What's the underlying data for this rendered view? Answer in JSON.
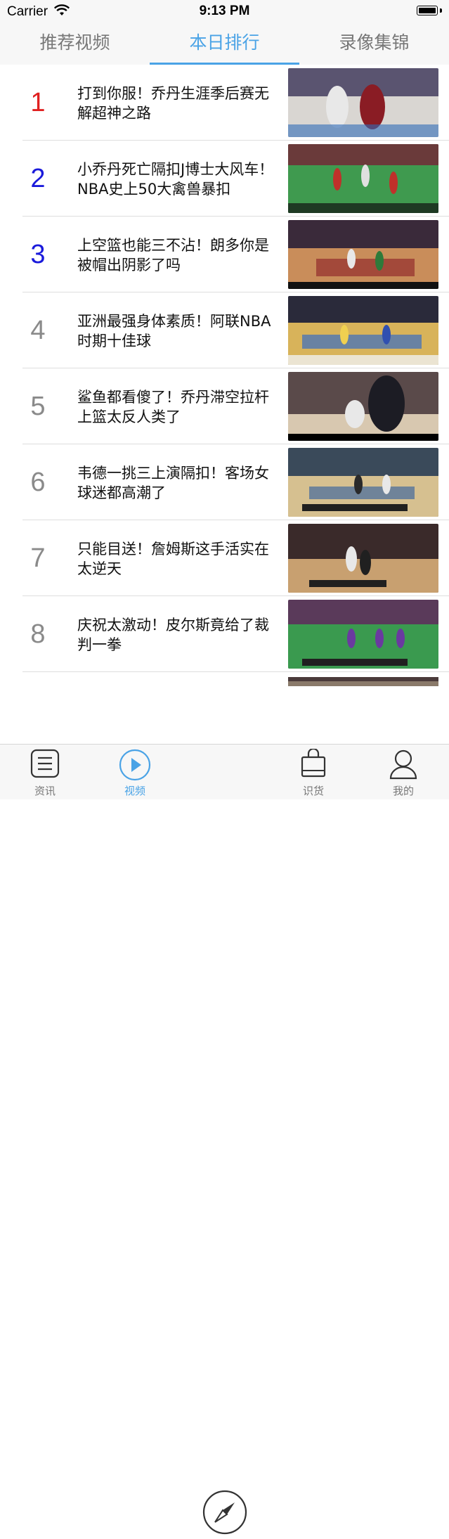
{
  "status_bar": {
    "carrier": "Carrier",
    "time": "9:13 PM"
  },
  "tabs": [
    {
      "label": "推荐视频",
      "active": false
    },
    {
      "label": "本日排行",
      "active": true
    },
    {
      "label": "录像集锦",
      "active": false
    }
  ],
  "videos": [
    {
      "rank": "1",
      "title": "打到你服！乔丹生涯季后赛无解超神之路"
    },
    {
      "rank": "2",
      "title": "小乔丹死亡隔扣J博士大风车！NBA史上50大禽兽暴扣"
    },
    {
      "rank": "3",
      "title": "上空篮也能三不沾！朗多你是被帽出阴影了吗"
    },
    {
      "rank": "4",
      "title": "亚洲最强身体素质！阿联NBA时期十佳球"
    },
    {
      "rank": "5",
      "title": "鲨鱼都看傻了！乔丹滞空拉杆上篮太反人类了"
    },
    {
      "rank": "6",
      "title": "韦德一挑三上演隔扣！客场女球迷都高潮了"
    },
    {
      "rank": "7",
      "title": "只能目送！詹姆斯这手活实在太逆天"
    },
    {
      "rank": "8",
      "title": "庆祝太激动！皮尔斯竟给了裁判一拳"
    }
  ],
  "tabbar": {
    "news": "资讯",
    "video": "视频",
    "compass_icon": "compass-icon",
    "goods": "识货",
    "mine": "我的"
  },
  "colors": {
    "accent": "#4aa3e6",
    "rank_top1": "#e02020",
    "rank_top2_3": "#1a1adb",
    "rank_other": "#8a8a8a"
  }
}
